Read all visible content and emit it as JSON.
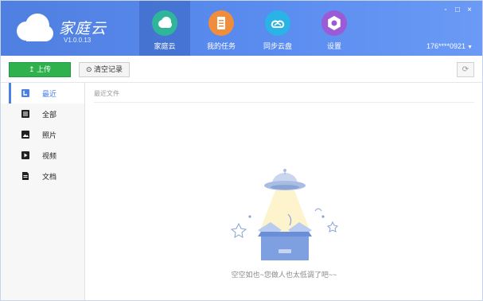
{
  "app": {
    "brand_name": "家庭云",
    "version": "V1.0.0.13"
  },
  "nav": {
    "tabs": [
      {
        "label": "家庭云",
        "icon": "cloud-icon",
        "color": "#2fb59a",
        "active": true
      },
      {
        "label": "我的任务",
        "icon": "task-list-icon",
        "color": "#f08d3c",
        "active": false
      },
      {
        "label": "同步云盘",
        "icon": "sync-cloud-icon",
        "color": "#29b3e6",
        "active": false
      },
      {
        "label": "设置",
        "icon": "gear-icon",
        "color": "#9b5bd6",
        "active": false
      }
    ]
  },
  "window_controls": {
    "minimize": "-",
    "maximize": "□",
    "close": "×"
  },
  "user": {
    "account": "176****0921",
    "caret": "▼"
  },
  "toolbar": {
    "upload_label": "上传",
    "upload_icon": "↥",
    "clear_label": "清空记录",
    "clear_icon": "⊙",
    "refresh_icon": "⟳"
  },
  "sidebar": {
    "items": [
      {
        "label": "最近",
        "icon": "recent-icon",
        "active": true
      },
      {
        "label": "全部",
        "icon": "all-files-icon",
        "active": false
      },
      {
        "label": "照片",
        "icon": "photo-icon",
        "active": false
      },
      {
        "label": "视频",
        "icon": "video-icon",
        "active": false
      },
      {
        "label": "文档",
        "icon": "document-icon",
        "active": false
      }
    ]
  },
  "main": {
    "section_title": "最近文件",
    "empty_message": "空空如也~您做人也太低调了吧~~",
    "empty_illustration": "ufo-empty-box-illustration"
  },
  "colors": {
    "header": "#5a8cf0",
    "accent": "#4a7fe3",
    "upload_green": "#2fb14e"
  }
}
